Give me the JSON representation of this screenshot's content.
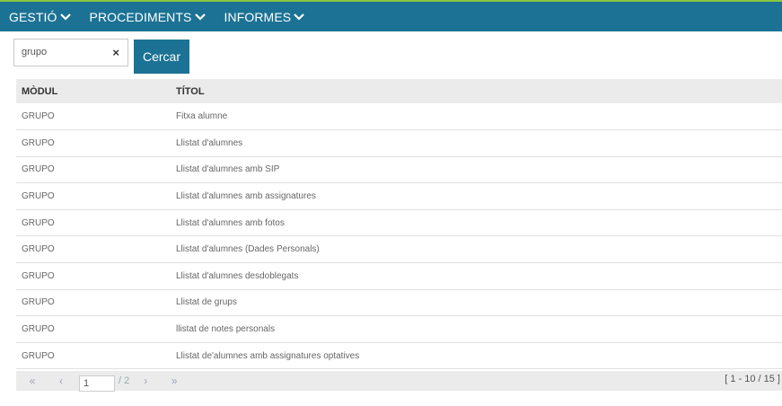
{
  "nav": {
    "items": [
      {
        "label": "GESTIÓ"
      },
      {
        "label": "PROCEDIMENTS"
      },
      {
        "label": "INFORMES"
      }
    ]
  },
  "search": {
    "value": "grupo",
    "clear_icon": "×",
    "button_label": "Cercar"
  },
  "table": {
    "headers": [
      "MÒDUL",
      "TÍTOL"
    ],
    "rows": [
      [
        "GRUPO",
        "Fitxa alumne"
      ],
      [
        "GRUPO",
        "Llistat d'alumnes"
      ],
      [
        "GRUPO",
        "Llistat d'alumnes amb SIP"
      ],
      [
        "GRUPO",
        "Llistat d'alumnes amb assignatures"
      ],
      [
        "GRUPO",
        "Llistat d'alumnes amb fotos"
      ],
      [
        "GRUPO",
        "Llistat d'alumnes (Dades Personals)"
      ],
      [
        "GRUPO",
        "Llistat d'alumnes desdoblegats"
      ],
      [
        "GRUPO",
        "Llistat de grups"
      ],
      [
        "GRUPO",
        "llistat de notes personals"
      ],
      [
        "GRUPO",
        "Llistat de'alumnes amb assignatures optatives"
      ]
    ]
  },
  "pager": {
    "first": "«",
    "prev": "‹",
    "page": "1",
    "total": "/ 2",
    "next": "›",
    "last": "»",
    "range": "[ 1 - 10 / 15 ]"
  },
  "colors": {
    "navbar": "#1b7294",
    "accent_line": "#8cc63f",
    "header_bg": "#ebebeb"
  }
}
